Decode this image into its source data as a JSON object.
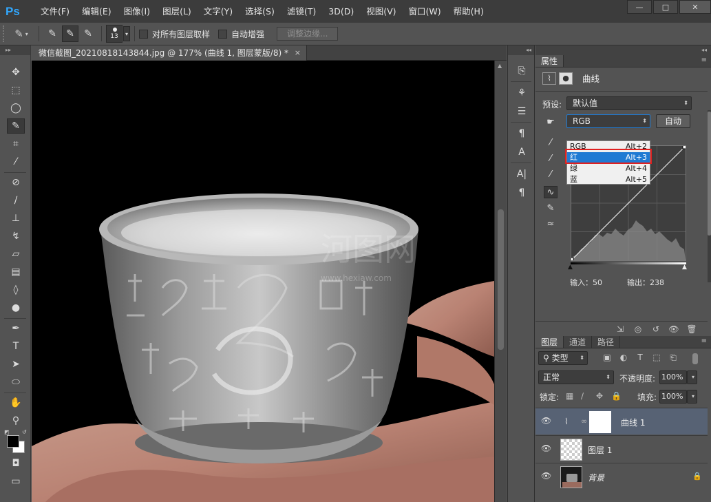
{
  "app": {
    "logo": "Ps"
  },
  "menu": [
    "文件(F)",
    "编辑(E)",
    "图像(I)",
    "图层(L)",
    "文字(Y)",
    "选择(S)",
    "滤镜(T)",
    "3D(D)",
    "视图(V)",
    "窗口(W)",
    "帮助(H)"
  ],
  "window_controls": {
    "minimize": "—",
    "maximize": "□",
    "close": "✕"
  },
  "options": {
    "brush_size": "13",
    "sample_all_layers": "对所有图层取样",
    "auto_enhance": "自动增强",
    "refine_edge": "调整边缘..."
  },
  "document": {
    "tab_title": "微信截图_20210818143844.jpg @ 177% (曲线 1, 图层蒙版/8) *",
    "close": "×",
    "watermark_cn": "河图网",
    "watermark_url": "www.hexiaw.com"
  },
  "properties": {
    "tab": "属性",
    "title": "曲线",
    "preset_label": "预设:",
    "preset_value": "默认值",
    "channel_value": "RGB",
    "auto_button": "自动",
    "channels": [
      {
        "name": "RGB",
        "shortcut": "Alt+2"
      },
      {
        "name": "红",
        "shortcut": "Alt+3"
      },
      {
        "name": "绿",
        "shortcut": "Alt+4"
      },
      {
        "name": "蓝",
        "shortcut": "Alt+5"
      }
    ],
    "selected_channel_index": 1,
    "input_label": "输入：",
    "input_value": "50",
    "output_label": "输出：",
    "output_value": "238"
  },
  "layers_panel": {
    "tabs": [
      "图层",
      "通道",
      "路径"
    ],
    "filter_kind": "类型",
    "blend_mode": "正常",
    "opacity_label": "不透明度:",
    "opacity_value": "100%",
    "lock_label": "锁定:",
    "fill_label": "填充:",
    "fill_value": "100%",
    "layers": [
      {
        "name": "曲线 1",
        "active": true
      },
      {
        "name": "图层 1",
        "active": false
      },
      {
        "name": "背景",
        "active": false
      }
    ]
  },
  "colors": {
    "accent": "#31a8ff",
    "selection": "#1f7ad3",
    "highlight_box": "#e02020",
    "active_layer": "#576274"
  }
}
